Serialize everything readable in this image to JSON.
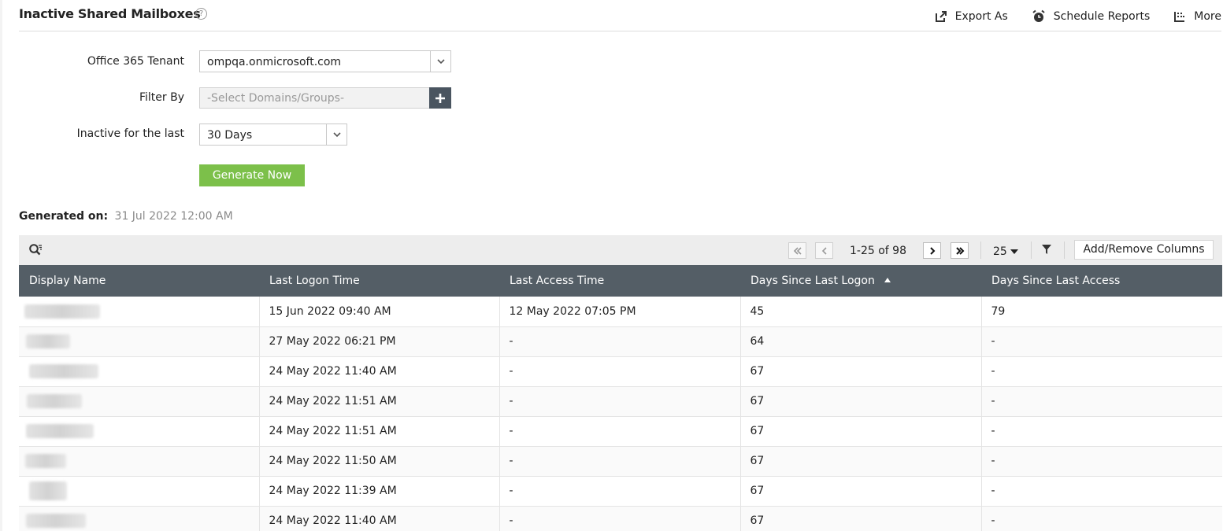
{
  "header": {
    "title": "Inactive Shared Mailboxes",
    "help": "?",
    "actions": [
      {
        "label": "Export As",
        "icon": "export-icon"
      },
      {
        "label": "Schedule Reports",
        "icon": "alarm-clock-icon"
      },
      {
        "label": "More",
        "icon": "more-icon"
      }
    ]
  },
  "form": {
    "tenant_label": "Office 365 Tenant",
    "tenant_value": "ompqa.onmicrosoft.com",
    "filter_label": "Filter By",
    "filter_placeholder": "-Select Domains/Groups-",
    "inactive_label": "Inactive for the last",
    "inactive_value": "30 Days",
    "generate_label": "Generate Now"
  },
  "generated": {
    "label": "Generated on:",
    "value": "31 Jul 2022 12:00 AM"
  },
  "toolbar": {
    "pagination": "1-25 of 98",
    "per_page": "25",
    "add_remove_columns": "Add/Remove Columns"
  },
  "table": {
    "columns": [
      "Display Name",
      "Last Logon Time",
      "Last Access Time",
      "Days Since Last Logon",
      "Days Since Last Access"
    ],
    "sorted_column": "Days Since Last Logon",
    "rows": [
      {
        "logon": "15 Jun 2022 09:40 AM",
        "access": "12 May 2022 07:05 PM",
        "days_logon": "45",
        "days_access": "79"
      },
      {
        "logon": "27 May 2022 06:21 PM",
        "access": "-",
        "days_logon": "64",
        "days_access": "-"
      },
      {
        "logon": "24 May 2022 11:40 AM",
        "access": "-",
        "days_logon": "67",
        "days_access": "-"
      },
      {
        "logon": "24 May 2022 11:51 AM",
        "access": "-",
        "days_logon": "67",
        "days_access": "-"
      },
      {
        "logon": "24 May 2022 11:51 AM",
        "access": "-",
        "days_logon": "67",
        "days_access": "-"
      },
      {
        "logon": "24 May 2022 11:50 AM",
        "access": "-",
        "days_logon": "67",
        "days_access": "-"
      },
      {
        "logon": "24 May 2022 11:39 AM",
        "access": "-",
        "days_logon": "67",
        "days_access": "-"
      },
      {
        "logon": "24 May 2022 11:40 AM",
        "access": "-",
        "days_logon": "67",
        "days_access": "-"
      }
    ]
  },
  "colors": {
    "header_bg": "#545e66",
    "generate_button": "#7cc04a",
    "plus_button": "#4a5560",
    "toolbar_bg": "#ededed"
  }
}
